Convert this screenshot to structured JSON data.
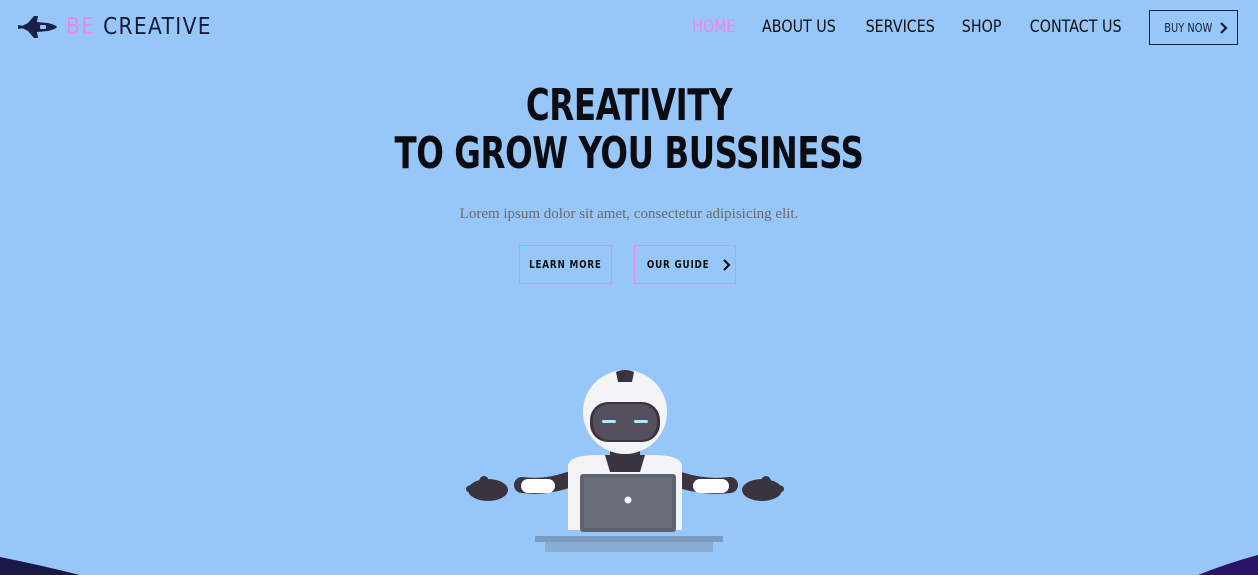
{
  "brand": {
    "prefix": "BE",
    "name": "CREATIVE"
  },
  "nav": {
    "items": [
      {
        "label": "HOME",
        "active": true
      },
      {
        "label": "ABOUT US",
        "active": false
      },
      {
        "label": "SERVICES",
        "active": false
      },
      {
        "label": "SHOP",
        "active": false
      },
      {
        "label": "CONTACT US",
        "active": false
      }
    ],
    "buy_label": "BUY NOW"
  },
  "hero": {
    "title_line1": "CREATIVITY",
    "title_line2": "TO GROW YOU BUSSINESS",
    "subtitle": "Lorem ipsum dolor sit amet, consectetur adipisicing elit.",
    "learn_more": "LEARN MORE",
    "our_guide": "OUR GUIDE"
  },
  "colors": {
    "background": "#97c7f9",
    "accent": "#e78ae6",
    "dark": "#161a3a"
  },
  "icons": {
    "logo": "spaceship-icon",
    "chevron": "chevron-right-icon",
    "hero": "robot-with-laptop-illustration"
  }
}
